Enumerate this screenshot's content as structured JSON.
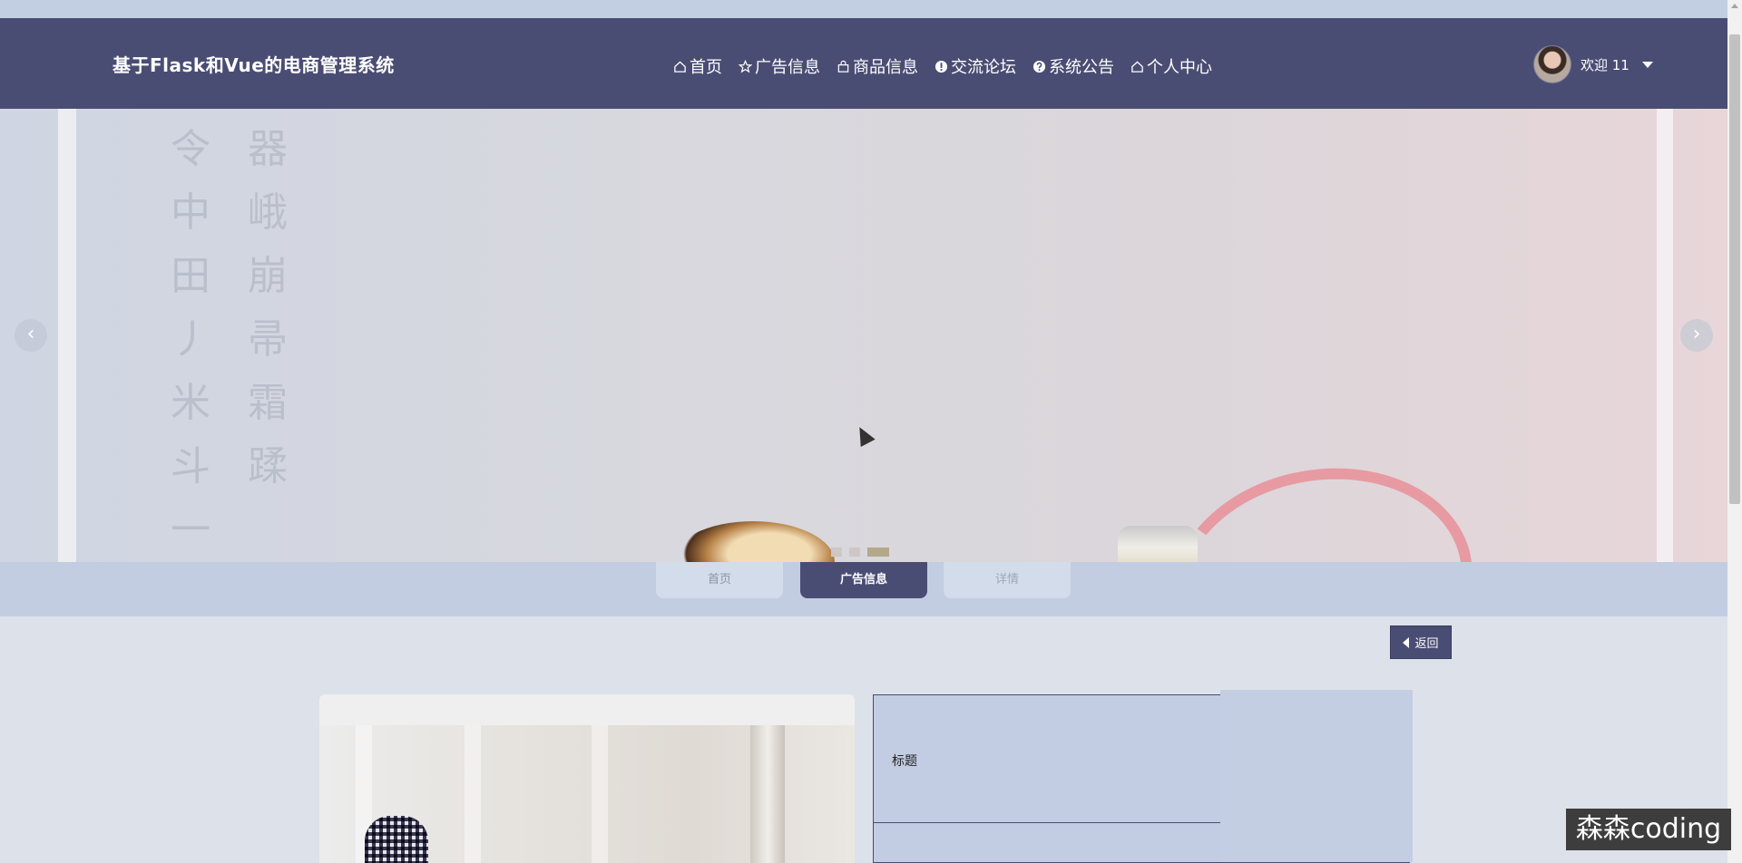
{
  "header": {
    "title": "基于Flask和Vue的电商管理系统",
    "menu": [
      {
        "label": "首页",
        "icon": "home-icon"
      },
      {
        "label": "广告信息",
        "icon": "star-icon"
      },
      {
        "label": "商品信息",
        "icon": "bag-icon"
      },
      {
        "label": "交流论坛",
        "icon": "info-circle-icon"
      },
      {
        "label": "系统公告",
        "icon": "question-circle-icon"
      },
      {
        "label": "个人中心",
        "icon": "home-icon"
      }
    ],
    "user_label": "欢迎 11"
  },
  "carousel": {
    "slide_count": 3,
    "active_index": 2
  },
  "breadcrumb": {
    "items": [
      "首页",
      "广告信息",
      "详情"
    ],
    "active_index": 1
  },
  "back_button": {
    "label": "返回"
  },
  "detail": {
    "field_label": "标题"
  },
  "watermark": "森森coding",
  "colors": {
    "primary": "#4a4d73",
    "light_band": "#c2cde2",
    "page_bg": "#dde1ea"
  }
}
